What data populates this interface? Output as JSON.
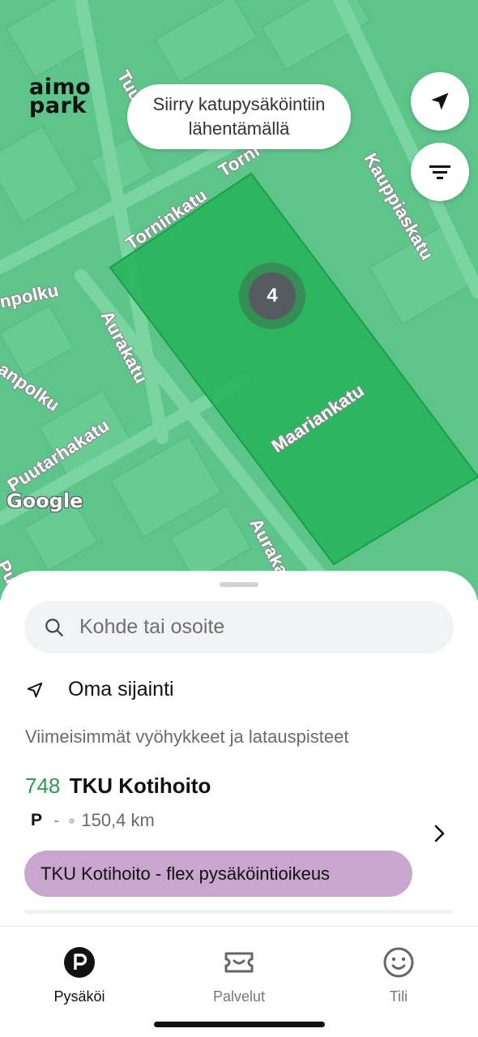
{
  "brand": {
    "line1": "aimo",
    "line2": "park"
  },
  "map": {
    "zoom_hint": "Siirry katupysäköintiin lähentämällä",
    "cluster_count": "4",
    "google_label": "Google",
    "streets": {
      "tuu": "Tuu",
      "torninkatu_top": "Torni",
      "torninkatu": "Torninkatu",
      "kauppiaskatu": "Kauppiaskatu",
      "aurakatu_left": "Aurakatu",
      "aurakatu_bottom": "Aurakatu",
      "maariankatu": "Maariankatu",
      "puutarhakatu": "Puutarhakatu",
      "polku1": "npolku",
      "polku2": "anpolku",
      "pu": "Pu"
    },
    "colors": {
      "base": "#5dc58a",
      "zone": "#22b357"
    }
  },
  "search": {
    "placeholder": "Kohde tai osoite"
  },
  "own_location": {
    "label": "Oma sijainti"
  },
  "recent": {
    "heading": "Viimeisimmät vyöhykkeet ja latauspisteet",
    "items": [
      {
        "code": "748",
        "name": "TKU Kotihoito",
        "type": "P",
        "separator": "-",
        "distance": "150,4 km",
        "permit": "TKU Kotihoito - flex pysäköintioikeus"
      }
    ]
  },
  "tabs": [
    {
      "label": "Pysäköi",
      "icon": "parking-icon",
      "active": true
    },
    {
      "label": "Palvelut",
      "icon": "ticket-icon",
      "active": false
    },
    {
      "label": "Tili",
      "icon": "smiley-icon",
      "active": false
    }
  ]
}
